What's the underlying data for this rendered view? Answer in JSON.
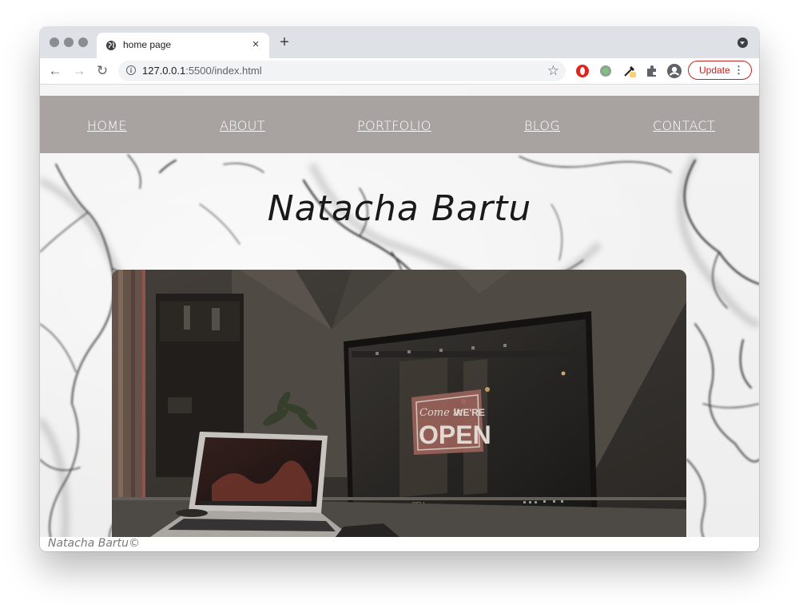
{
  "browser": {
    "tab_title": "home page",
    "tab_close": "×",
    "new_tab": "+",
    "url_host": "127.0.0.1",
    "url_rest": ":5500/index.html",
    "update_label": "Update",
    "more_label": "⋮",
    "back": "←",
    "forward": "→",
    "reload": "↻",
    "star": "☆",
    "info": "i",
    "icons": [
      "globe-icon",
      "back-icon",
      "forward-icon",
      "reload-icon",
      "info-icon",
      "star-icon",
      "opera-extension-icon",
      "green-extension-icon",
      "eyedropper-extension-icon",
      "puzzle-extensions-icon",
      "profile-icon",
      "more-icon"
    ]
  },
  "nav": {
    "items": [
      {
        "label": "HOME"
      },
      {
        "label": "ABOUT"
      },
      {
        "label": "PORTFOLIO"
      },
      {
        "label": "BLOG"
      },
      {
        "label": "CONTACT"
      }
    ],
    "background": "#a8a3a1"
  },
  "hero": {
    "title": "Natacha Bartu",
    "monitor_sign_script": "Come in",
    "monitor_sign_top": "WE'RE",
    "monitor_sign_big": "OPEN",
    "monitor_brand": "DELL"
  },
  "footer": {
    "text": "Natacha Bartu©"
  }
}
